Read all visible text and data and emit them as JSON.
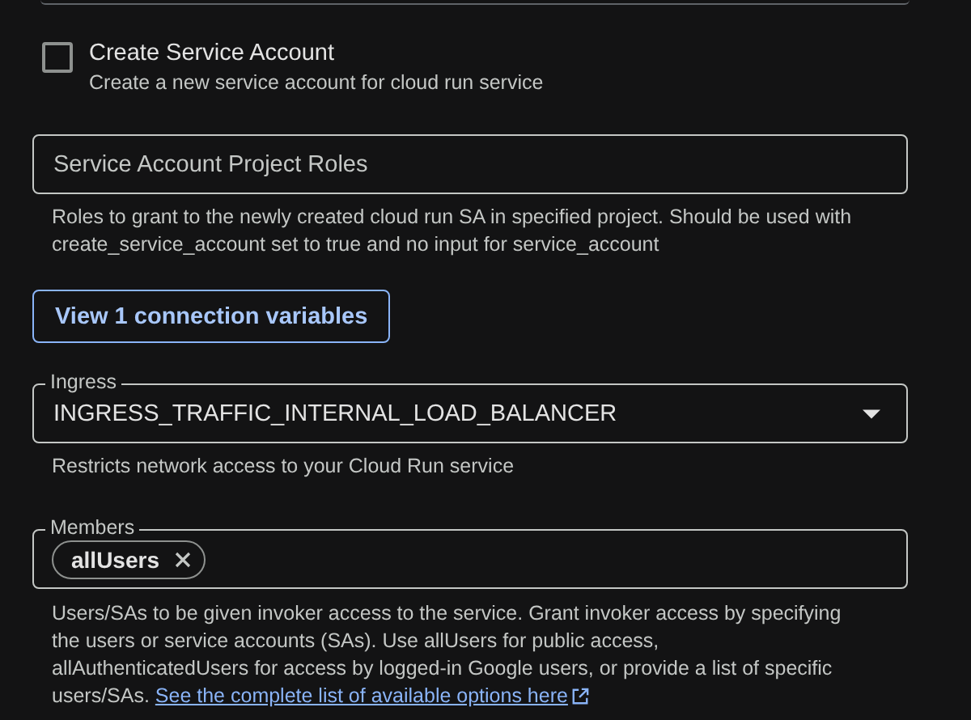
{
  "create_service_account": {
    "label": "Create Service Account",
    "description": "Create a new service account for cloud run service",
    "checked": false
  },
  "project_roles": {
    "placeholder": "Service Account Project Roles",
    "help": "Roles to grant to the newly created cloud run SA in specified project. Should be used with create_service_account set to true and no input for service_account"
  },
  "connection_button": "View 1 connection variables",
  "ingress": {
    "label": "Ingress",
    "value": "INGRESS_TRAFFIC_INTERNAL_LOAD_BALANCER",
    "help": "Restricts network access to your Cloud Run service"
  },
  "members": {
    "label": "Members",
    "chips": [
      "allUsers"
    ],
    "help": "Users/SAs to be given invoker access to the service. Grant invoker access by specifying the users or service accounts (SAs). Use allUsers for public access, allAuthenticatedUsers for access by logged-in Google users, or provide a list of specific users/SAs.",
    "link": "See the complete list of available options here"
  }
}
